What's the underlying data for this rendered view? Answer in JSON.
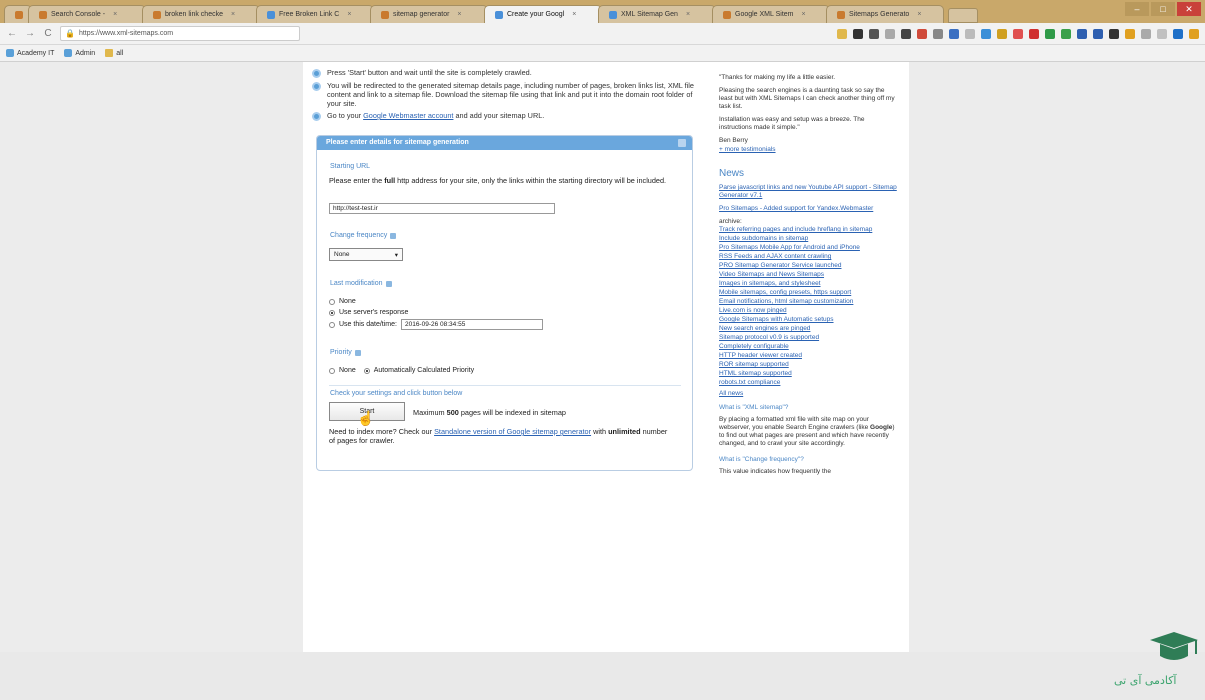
{
  "browser": {
    "tabs": [
      {
        "label": "",
        "color": "#c97a2e",
        "active": false
      },
      {
        "label": "Search Console - ",
        "color": "#c97a2e",
        "active": false
      },
      {
        "label": "broken link checke",
        "color": "#c97a2e",
        "active": false
      },
      {
        "label": "Free Broken Link C",
        "color": "#4a90d9",
        "active": false
      },
      {
        "label": "sitemap generator",
        "color": "#c97a2e",
        "active": false
      },
      {
        "label": "Create your Googl",
        "color": "#4a90d9",
        "active": true
      },
      {
        "label": "XML Sitemap Gen",
        "color": "#4a90d9",
        "active": false
      },
      {
        "label": "Google XML Sitem",
        "color": "#c97a2e",
        "active": false
      },
      {
        "label": "Sitemaps Generato",
        "color": "#c97a2e",
        "active": false
      }
    ],
    "address": "https://www.xml-sitemaps.com",
    "bookmarks": [
      {
        "label": "Academy IT",
        "folder": false
      },
      {
        "label": "Admin",
        "folder": false
      },
      {
        "label": "all",
        "folder": true
      }
    ]
  },
  "steps": {
    "s1": "Press 'Start' button and wait until the site is completely crawled.",
    "s2": "You will be redirected to the generated sitemap details page, including number of pages, broken links list, XML file content and link to a sitemap file. Download the sitemap file using that link and put it into the domain root folder of your site.",
    "s3_pre": "Go to your",
    "s3_link": "Google Webmaster account",
    "s3_post": "and add your sitemap URL."
  },
  "form": {
    "header": "Please enter details for sitemap generation",
    "starting_url_title": "Starting URL",
    "starting_url_text_pre": "Please enter the",
    "starting_url_text_bold": "full",
    "starting_url_text_post": "http address for your site, only the links within the starting directory will be included.",
    "starting_url_value": "http://test-test.ir",
    "change_frequency_title": "Change frequency",
    "change_frequency_value": "None",
    "last_mod_title": "Last modification",
    "last_mod_options": [
      "None",
      "Use server's response",
      "Use this date/time:"
    ],
    "last_mod_date": "2016-09-26 08:34:55",
    "priority_title": "Priority",
    "priority_options": [
      "None",
      "Automatically Calculated Priority"
    ],
    "check_title": "Check your settings and click button below",
    "start_label": "Start",
    "max_pre": "Maximum",
    "max_bold": "500",
    "max_post": "pages will be indexed in sitemap",
    "more_pre": "Need to index more? Check our",
    "more_link": "Standalone version of Google sitemap generator",
    "more_mid": "with",
    "more_bold": "unlimited",
    "more_post": "number of pages for crawler."
  },
  "sidebar": {
    "quote": "\"Thanks for making my life a little easier.",
    "quote2": "Pleasing the search engines is a daunting task so say the least but with XML Sitemaps I can check another thing off my task list.",
    "quote3": "Installation was easy and setup was a breeze. The instructions made it simple.\"",
    "author": "Ben Berry",
    "more_testimonials": "+ more testimonials",
    "news_title": "News",
    "news1": "Parse javascript links and new Youtube API support - Sitemap Generator v7.1",
    "news2": "Pro Sitemaps - Added support for Yandex.Webmaster",
    "archive_label": "archive:",
    "archive_links": [
      "Track referring pages and include hreflang in sitemap",
      "Include subdomains in sitemap",
      "Pro Sitemaps Mobile App for Android and iPhone",
      "RSS Feeds and AJAX content crawling",
      "PRO Sitemap Generator Service launched",
      "Video Sitemaps and News Sitemaps",
      "Images in sitemaps, and stylesheet",
      "Mobile sitemaps, config presets, https support",
      "Email notifications, html sitemap customization",
      "Live.com is now pinged",
      "Google Sitemaps with Automatic setups",
      "New search engines are pinged",
      "Sitemap protocol v0.9 is supported",
      "Completely configurable",
      "HTTP header viewer created",
      "ROR sitemap supported",
      "HTML sitemap supported",
      "robots.txt compliance"
    ],
    "all_news": "All news",
    "what_is_title": "What is \"XML sitemap\"?",
    "what_is_text_pre": "By placing a formatted xml file with site map on your webserver, you enable Search Engine crawlers (like",
    "what_is_text_bold": "Google",
    "what_is_text_post": ") to find out what pages are present and which have recently changed, and to crawl your site accordingly.",
    "change_freq_title": "What is \"Change frequency\"?",
    "change_freq_text": "This value indicates how frequently the"
  },
  "watermark": {
    "text": "آکادمی آی تی"
  }
}
